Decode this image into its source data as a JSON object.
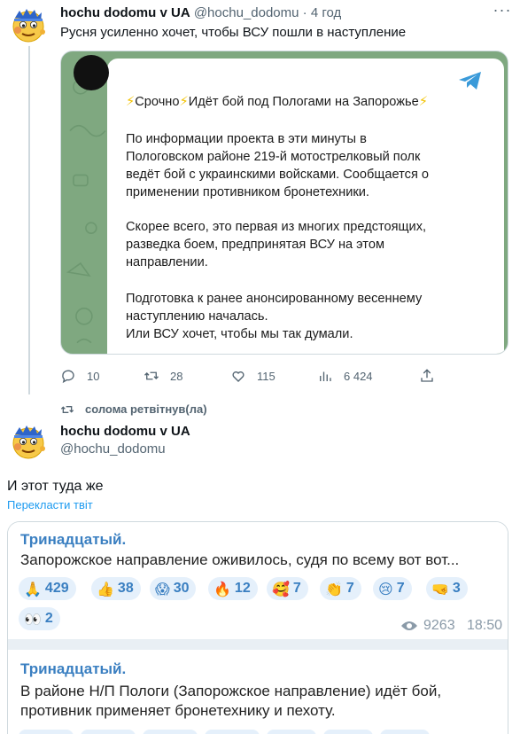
{
  "tweet": {
    "author_name": "hochu dodomu v UA",
    "author_handle": "@hochu_dodomu",
    "separator": " · ",
    "time": "4 год",
    "text": "Русня усиленно хочет, чтобы ВСУ пошли в наступление",
    "media": {
      "title_prefix": "⚡",
      "title_word1": "Срочно",
      "title_mid": "⚡",
      "title_rest": "Идёт бой под Пологами на Запорожье",
      "title_suffix": "⚡",
      "paragraph1": [
        "По информации проекта                    в эти минуты в",
        "Пологовском районе 219-й мотострелковый полк",
        "ведёт бой с украинскими войсками. Сообщается о",
        "применении противником бронетехники."
      ],
      "paragraph2": [
        "Скорее всего, это первая из многих предстоящих,",
        "разведка боем, предпринятая ВСУ на этом",
        "направлении."
      ],
      "paragraph3": [
        "Подготовка к ранее анонсированному весеннему",
        "наступлению началась.",
        "Или ВСУ хочет, чтобы мы так думали."
      ]
    },
    "actions": {
      "replies": "10",
      "retweets": "28",
      "likes": "115",
      "views": "6 424"
    }
  },
  "retweet": {
    "label": "солома ретвітнув(ла)",
    "author_name": "hochu dodomu v UA",
    "author_handle": "@hochu_dodomu",
    "text": "И этот туда же",
    "translate": "Перекласти твіт",
    "quote": {
      "post1": {
        "channel": "Тринадцатый.",
        "text": "Запорожское направление оживилось,  судя по всему вот вот...",
        "reactions": [
          {
            "emoji": "🙏",
            "count": "429"
          },
          {
            "emoji": "👍",
            "count": "38"
          },
          {
            "emoji": "😱",
            "count": "30"
          },
          {
            "emoji": "🔥",
            "count": "12"
          },
          {
            "emoji": "🥰",
            "count": "7"
          },
          {
            "emoji": "👏",
            "count": "7"
          },
          {
            "emoji": "😢",
            "count": "7"
          },
          {
            "emoji": "🤜",
            "count": "3"
          },
          {
            "emoji": "👀",
            "count": "2"
          }
        ],
        "views": "9263",
        "time": "18:50"
      },
      "post2": {
        "channel": "Тринадцатый.",
        "line1": "В районе Н/П Пологи (Запорожское направление) идёт бой,",
        "line2": "противник применяет бронетехнику и пехоту."
      }
    }
  },
  "colors": {
    "accent": "#1d9bf0",
    "muted": "#536471",
    "telegram_link": "#3a7fc1",
    "telegram_bg": "#7fa880"
  },
  "icons": [
    "more-icon",
    "reply-icon",
    "retweet-icon",
    "like-icon",
    "views-icon",
    "share-icon",
    "telegram-icon",
    "eye-icon"
  ]
}
